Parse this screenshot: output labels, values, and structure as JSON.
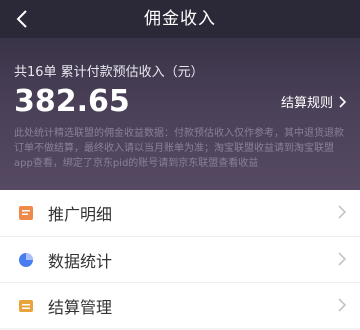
{
  "nav": {
    "title": "佣金收入",
    "back_icon": "chevron-left-icon"
  },
  "summary": {
    "count_text": "共16单 累计付款预估收入（元）",
    "amount": "382.65",
    "rules_label": "结算规则",
    "note": "此处统计精选联盟的佣金收益数据：付款预估收入仅作参考，其中退货退款订单不做结算，最终收入请以当月账单为准；淘宝联盟收益请到淘宝联盟app查看，绑定了京东pid的账号请到京东联盟查看收益"
  },
  "menu": {
    "items": [
      {
        "label": "推广明细",
        "icon": "document-icon",
        "icon_color": "#f08a4b"
      },
      {
        "label": "数据统计",
        "icon": "pie-chart-icon",
        "icon_color": "#4a7ef0"
      },
      {
        "label": "结算管理",
        "icon": "wallet-icon",
        "icon_color": "#e8a33b"
      }
    ]
  },
  "colors": {
    "nav_bg": "#2b2837",
    "header_top": "#3a3448",
    "header_bottom": "#564a63",
    "note_text": "#8a8198"
  }
}
